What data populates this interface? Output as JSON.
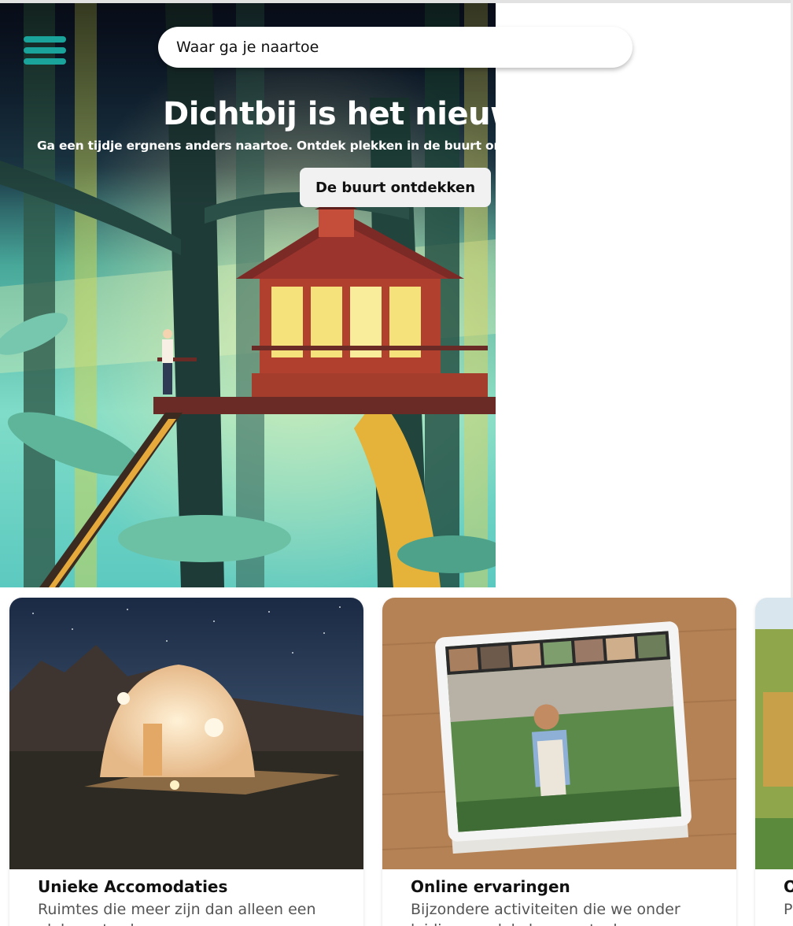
{
  "search": {
    "placeholder": "Waar ga je naartoe"
  },
  "hero": {
    "title": "Dichtbij is het nieuwe",
    "subtitle": "Ga een tijdje ergnens anders naartoe. Ontdek plekken in de buurt om",
    "cta_label": "De buurt ontdekken"
  },
  "cards": [
    {
      "title": "Unieke Accomodaties",
      "description": "Ruimtes die meer zijn dan alleen een plek om te slapen"
    },
    {
      "title": "Online ervaringen",
      "description": "Bijzondere activiteiten die we onder leiding van lokale experts doen"
    },
    {
      "title": "O",
      "description": "P"
    }
  ],
  "colors": {
    "accent": "#1aa39a",
    "cta_bg": "#f1f1f1"
  },
  "icons": {
    "menu": "hamburger-menu-icon"
  }
}
